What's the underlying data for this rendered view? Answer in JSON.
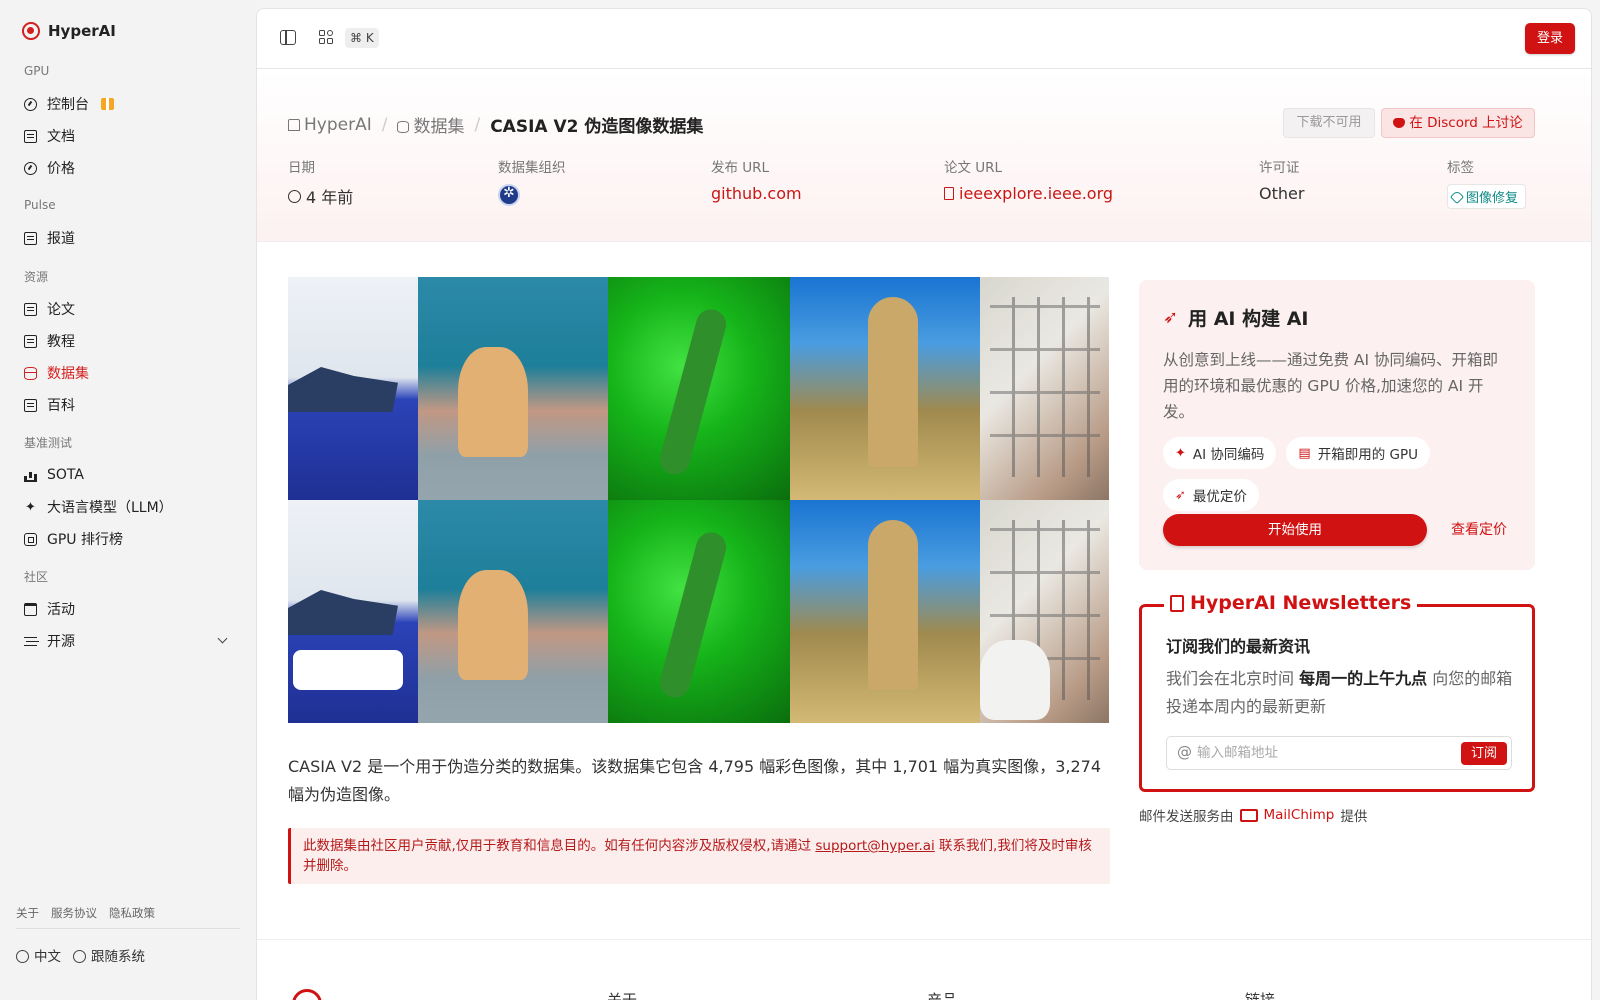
{
  "app": {
    "brand": "HyperAI"
  },
  "sidebar": {
    "sections": [
      {
        "label": "GPU",
        "items": [
          {
            "label": "控制台",
            "icon": "dashboard-icon",
            "badge_icon": "gift-icon"
          },
          {
            "label": "文档",
            "icon": "document-icon"
          },
          {
            "label": "价格",
            "icon": "dollar-icon"
          }
        ]
      },
      {
        "label": "Pulse",
        "items": [
          {
            "label": "报道",
            "icon": "news-icon"
          }
        ]
      },
      {
        "label": "资源",
        "items": [
          {
            "label": "论文",
            "icon": "paper-icon"
          },
          {
            "label": "教程",
            "icon": "book-icon"
          },
          {
            "label": "数据集",
            "icon": "database-icon",
            "active": true
          },
          {
            "label": "百科",
            "icon": "wiki-icon"
          }
        ]
      },
      {
        "label": "基准测试",
        "items": [
          {
            "label": "SOTA",
            "icon": "bar-chart-icon"
          },
          {
            "label": "大语言模型（LLM）",
            "icon": "sparkle-icon"
          },
          {
            "label": "GPU 排行榜",
            "icon": "chip-icon"
          }
        ]
      },
      {
        "label": "社区",
        "items": [
          {
            "label": "活动",
            "icon": "calendar-icon"
          },
          {
            "label": "开源",
            "icon": "list-icon",
            "expandable": true
          }
        ]
      }
    ],
    "footer_links": [
      "关于",
      "服务协议",
      "隐私政策"
    ],
    "language": "中文",
    "theme": "跟随系统"
  },
  "topbar": {
    "shortcut": "⌘ K",
    "login": "登录"
  },
  "breadcrumb": {
    "home": "HyperAI",
    "section": "数据集",
    "current": "CASIA V2 伪造图像数据集"
  },
  "actions": {
    "download": "下载不可用",
    "discord": "在 Discord 上讨论"
  },
  "meta": {
    "date_label": "日期",
    "date_value": "4 年前",
    "org_label": "数据集组织",
    "url_label": "发布 URL",
    "url_value": "github.com",
    "paper_label": "论文 URL",
    "paper_value": "ieeexplore.ieee.org",
    "license_label": "许可证",
    "license_value": "Other",
    "tags_label": "标签",
    "tag_value": "图像修复"
  },
  "description": "CASIA V2 是一个用于伪造分类的数据集。该数据集它包含 4,795 幅彩色图像，其中 1,701 幅为真实图像，3,274 幅为伪造图像。",
  "notice": {
    "before": "此数据集由社区用户贡献,仅用于教育和信息目的。如有任何内容涉及版权侵权,请通过 ",
    "email": "support@hyper.ai",
    "after": " 联系我们,我们将及时审核并删除。"
  },
  "ai_card": {
    "title": "用 AI 构建 AI",
    "desc": "从创意到上线——通过免费 AI 协同编码、开箱即用的环境和最优惠的 GPU 价格,加速您的 AI 开发。",
    "pills": [
      "AI 协同编码",
      "开箱即用的 GPU",
      "最优定价"
    ],
    "start": "开始使用",
    "pricing": "查看定价"
  },
  "newsletter": {
    "legend": "HyperAI Newsletters",
    "heading": "订阅我们的最新资讯",
    "text_before": "我们会在北京时间 ",
    "text_bold": "每周一的上午九点",
    "text_after": " 向您的邮箱投递本周内的最新更新",
    "placeholder": "输入邮箱地址",
    "subscribe": "订阅",
    "provider_before": "邮件发送服务由",
    "provider": "MailChimp",
    "provider_after": "提供"
  },
  "footer": {
    "col1": "关于",
    "col2": "产品",
    "col3": "链接"
  },
  "colors": {
    "accent": "#d01212",
    "tag": "#0d8a86"
  }
}
